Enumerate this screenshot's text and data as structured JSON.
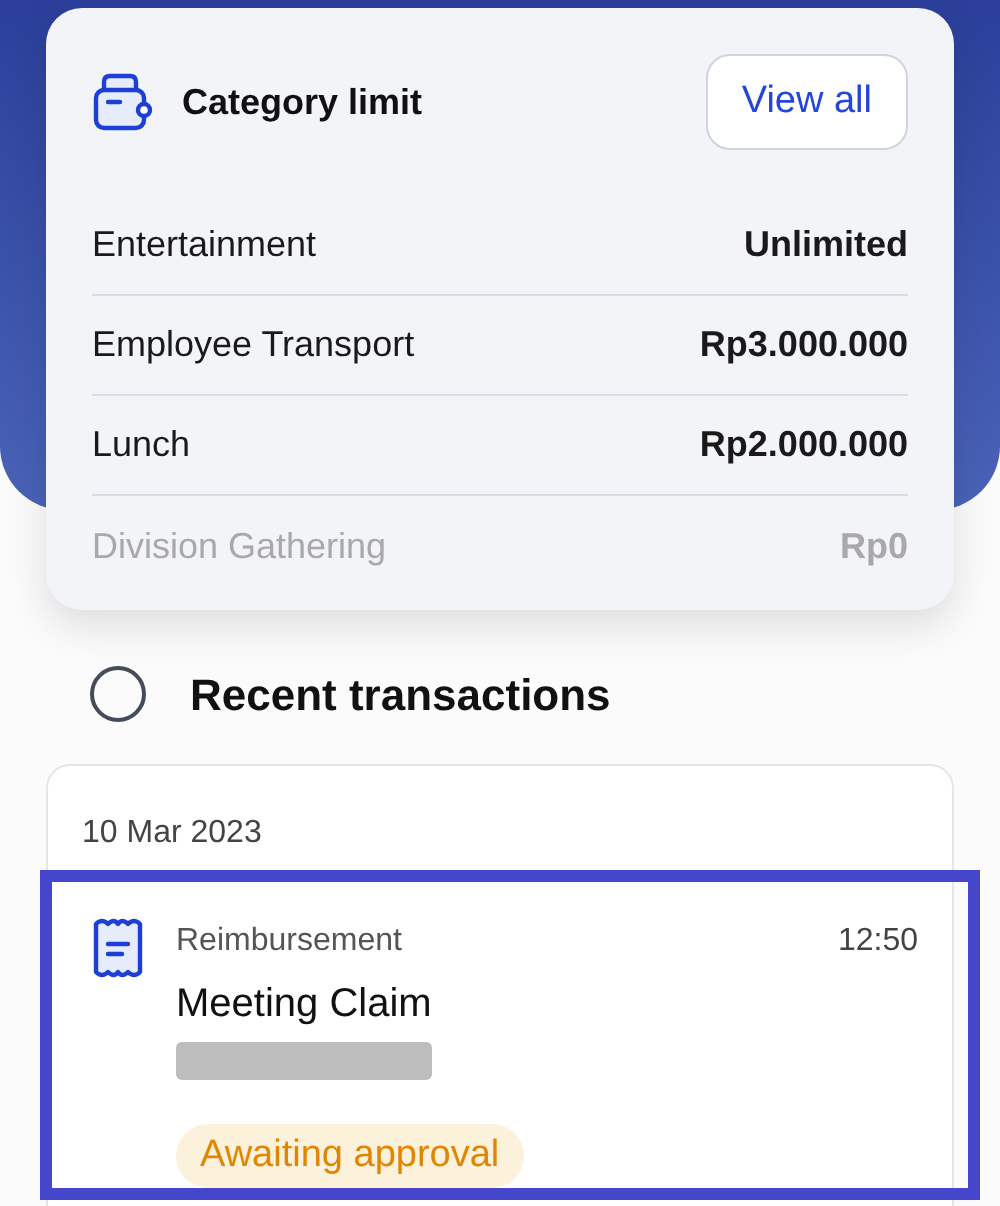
{
  "category_limit": {
    "title": "Category limit",
    "view_all": "View all",
    "rows": [
      {
        "name": "Entertainment",
        "amount": "Unlimited",
        "faded": false
      },
      {
        "name": "Employee Transport",
        "amount": "Rp3.000.000",
        "faded": false
      },
      {
        "name": "Lunch",
        "amount": "Rp2.000.000",
        "faded": false
      },
      {
        "name": "Division Gathering",
        "amount": "Rp0",
        "faded": true
      }
    ]
  },
  "recent": {
    "title": "Recent transactions",
    "groups": [
      {
        "date": "10 Mar 2023",
        "transactions": [
          {
            "type": "Reimbursement",
            "time": "12:50",
            "title": "Meeting Claim",
            "status": "Awaiting approval",
            "highlighted": true
          }
        ]
      }
    ]
  }
}
